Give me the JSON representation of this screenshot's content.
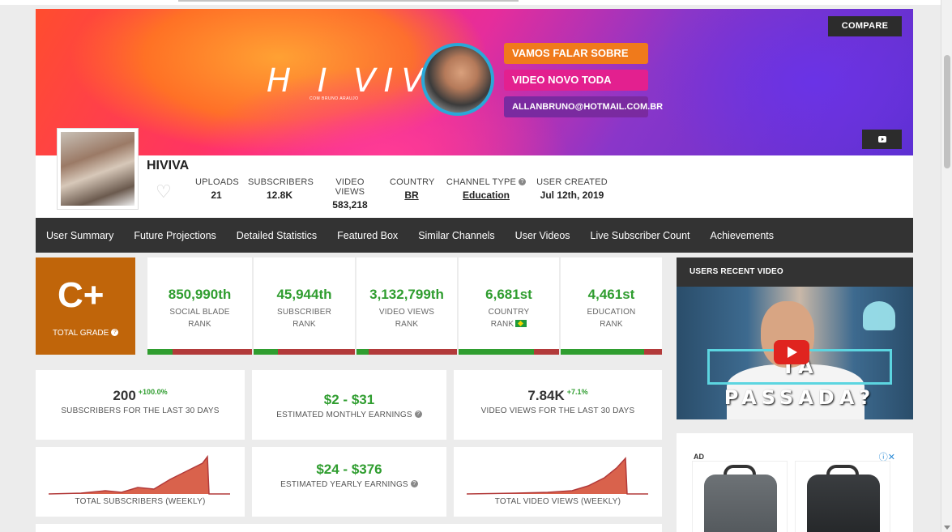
{
  "banner": {
    "logo_text": "H I VIVA",
    "logo_sub": "COM BRUNO ARAUJO",
    "tag1": "VAMOS FALAR SOBRE HIV!",
    "tag2": "VIDEO NOVO TODA TERÇA",
    "tag3": "ALLANBRUNO@HOTMAIL.COM.BR",
    "compare": "COMPARE"
  },
  "channel": {
    "name": "HIVIVA",
    "stats": [
      {
        "label": "UPLOADS",
        "value": "21"
      },
      {
        "label": "SUBSCRIBERS",
        "value": "12.8K"
      },
      {
        "label": "VIDEO VIEWS",
        "value": "583,218"
      },
      {
        "label": "COUNTRY",
        "value": "BR"
      },
      {
        "label": "CHANNEL TYPE",
        "value": "Education"
      },
      {
        "label": "USER CREATED",
        "value": "Jul 12th, 2019"
      }
    ]
  },
  "nav": [
    "User Summary",
    "Future Projections",
    "Detailed Statistics",
    "Featured Box",
    "Similar Channels",
    "User Videos",
    "Live Subscriber Count",
    "Achievements"
  ],
  "grade": {
    "value": "C+",
    "label": "TOTAL GRADE"
  },
  "ranks": [
    {
      "num": "850,990th",
      "line1": "SOCIAL BLADE",
      "line2": "RANK",
      "fill": 0.24
    },
    {
      "num": "45,944th",
      "line1": "SUBSCRIBER",
      "line2": "RANK",
      "fill": 0.24
    },
    {
      "num": "3,132,799th",
      "line1": "VIDEO VIEWS",
      "line2": "RANK",
      "fill": 0.12
    },
    {
      "num": "6,681st",
      "line1": "COUNTRY",
      "line2": "RANK",
      "fill": 0.75
    },
    {
      "num": "4,461st",
      "line1": "EDUCATION",
      "line2": "RANK",
      "fill": 0.82
    }
  ],
  "cards": {
    "subs30": {
      "value": "200",
      "pct": "+100.0%",
      "label": "SUBSCRIBERS FOR THE LAST 30 DAYS"
    },
    "monthly": {
      "value": "$2  -  $31",
      "label": "ESTIMATED MONTHLY EARNINGS"
    },
    "views30": {
      "value": "7.84K",
      "pct": "+7.1%",
      "label": "VIDEO VIEWS FOR THE LAST 30 DAYS"
    },
    "subs_weekly": {
      "label": "TOTAL SUBSCRIBERS (WEEKLY)"
    },
    "yearly": {
      "value": "$24  -  $376",
      "label": "ESTIMATED YEARLY EARNINGS"
    },
    "views_weekly": {
      "label": "TOTAL VIDEO VIEWS (WEEKLY)"
    }
  },
  "sidebar": {
    "video_header": "USERS RECENT VIDEO",
    "video_title_overlay": "TA PASSADA?",
    "ad_label": "AD"
  },
  "colors": {
    "grade": "#c0650a",
    "green": "#2f9d2f",
    "red": "#b23a3a",
    "nav": "#333333"
  }
}
